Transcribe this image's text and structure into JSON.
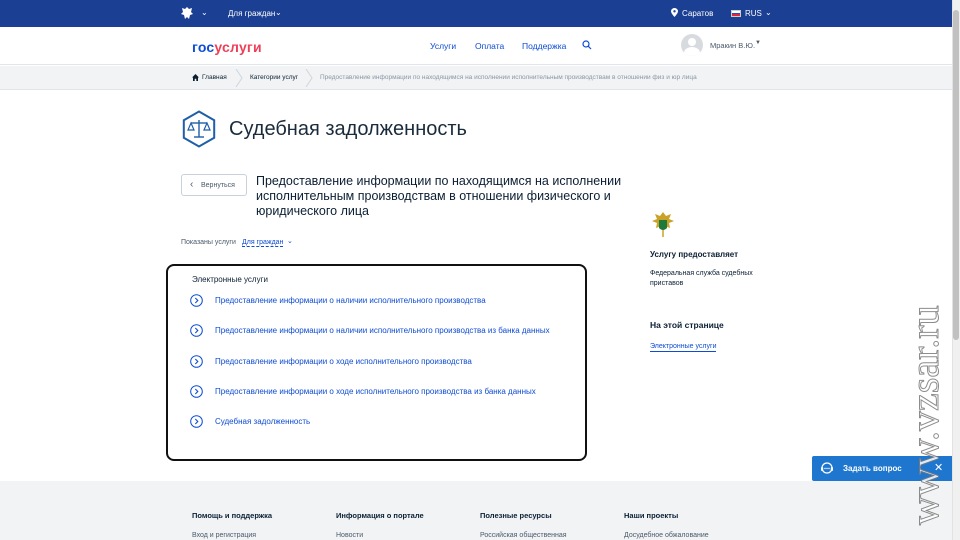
{
  "topbar": {
    "audience": "Для граждан",
    "location": "Саратов",
    "language": "RUS",
    "icons": [
      "emblem-icon",
      "chevron-down-icon",
      "location-pin-icon",
      "russia-flag-icon"
    ]
  },
  "header": {
    "logo_part1": "гос",
    "logo_part2": "услуги",
    "nav": [
      "Услуги",
      "Оплата",
      "Поддержка"
    ],
    "user_name": "Мракин В.Ю."
  },
  "breadcrumb": {
    "home": "Главная",
    "category": "Категории услуг",
    "current": "Предоставление информации по находящимся на исполнении исполнительным производствам в отношении физ и юр лица"
  },
  "category": {
    "title": "Судебная задолженность"
  },
  "service": {
    "back_label": "Вернуться",
    "title": "Предоставление информации по находящимся на исполнении исполнительным производствам в отношении физического и юридического лица",
    "shown_label": "Показаны услуги",
    "shown_value": "Для граждан"
  },
  "electronic": {
    "heading": "Электронные услуги",
    "items": [
      "Предоставление информации о наличии исполнительного производства",
      "Предоставление информации о наличии исполнительного производства из банка данных",
      "Предоставление информации о ходе исполнительного производства",
      "Предоставление информации о ходе исполнительного производства из банка данных",
      "Судебная задолженность"
    ]
  },
  "sidebar": {
    "provider_heading": "Услугу предоставляет",
    "provider_name": "Федеральная служба судебных приставов",
    "on_page_heading": "На этой странице",
    "on_page_link": "Электронные услуги"
  },
  "ask": {
    "label": "Задать вопрос"
  },
  "footer": {
    "columns": [
      {
        "heading": "Помощь и поддержка",
        "link": "Вход и регистрация"
      },
      {
        "heading": "Информация о портале",
        "link": "Новости"
      },
      {
        "heading": "Полезные ресурсы",
        "link": "Российская общественная"
      },
      {
        "heading": "Наши проекты",
        "link": "Досудебное обжалование"
      }
    ]
  },
  "watermark": "www.vzsar.ru",
  "colors": {
    "topbar": "#1b3f93",
    "link": "#0d4cd3",
    "logo_red": "#ee3f58",
    "ask_button": "#1f76cf"
  }
}
